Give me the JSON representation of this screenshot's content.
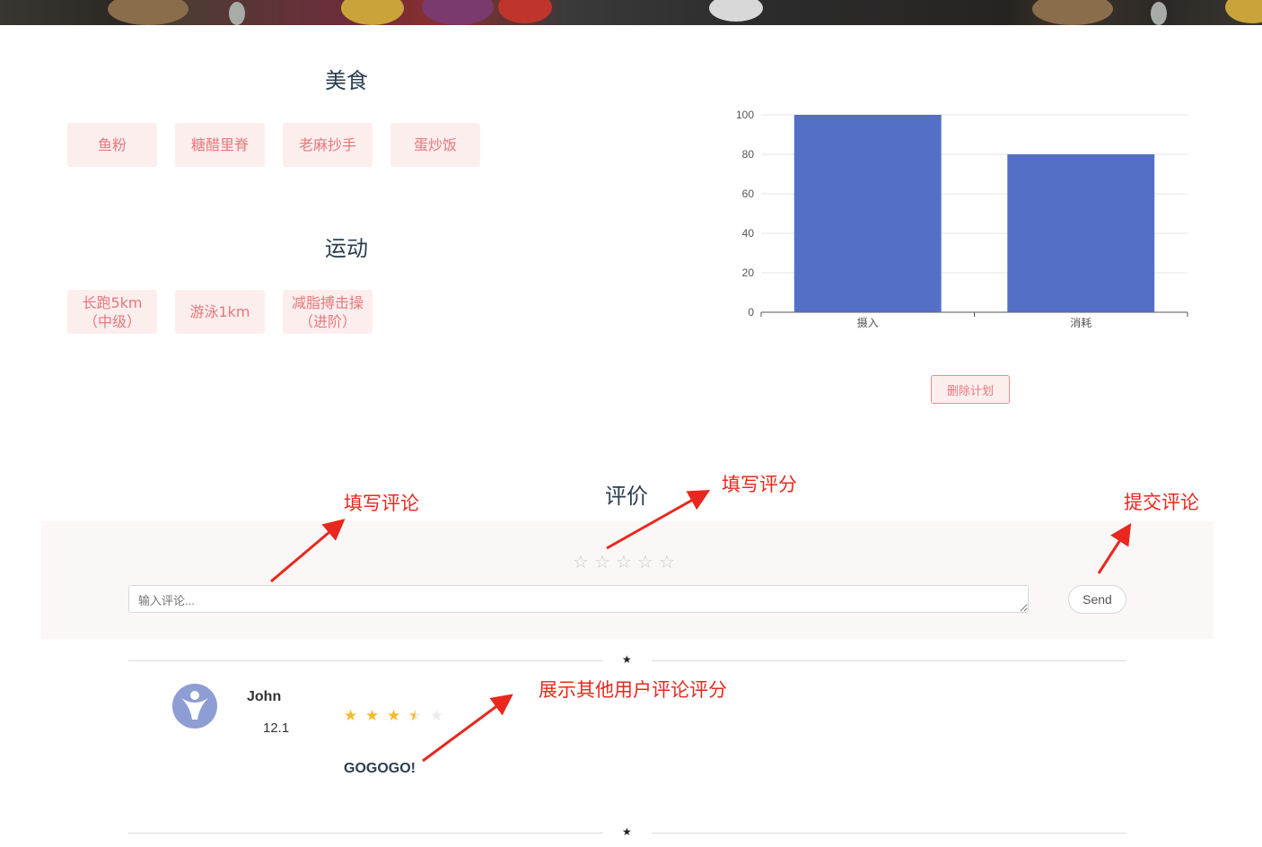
{
  "banner": {
    "description_icon": "food-banner-image"
  },
  "food": {
    "title": "美食",
    "tags": [
      "鱼粉",
      "糖醋里脊",
      "老麻抄手",
      "蛋炒饭"
    ]
  },
  "sport": {
    "title": "运动",
    "tags": [
      "长跑5km（中级）",
      "游泳1km",
      "减脂搏击操（进阶）"
    ]
  },
  "chart_data": {
    "type": "bar",
    "categories": [
      "摄入",
      "消耗"
    ],
    "values": [
      100,
      80
    ],
    "ylim": [
      0,
      100
    ],
    "yticks": [
      0,
      20,
      40,
      60,
      80,
      100
    ],
    "bar_color": "#5470c6",
    "grid": true
  },
  "plan": {
    "delete_label": "删除计划"
  },
  "review": {
    "title": "评价",
    "rating_max": 5,
    "input_placeholder": "输入评论...",
    "send_label": "Send"
  },
  "comments": [
    {
      "user": "John",
      "date": "12.1",
      "rating": 3.5,
      "text": "GOGOGO!"
    }
  ],
  "annotations": {
    "write_comment": "填写评论",
    "write_rating": "填写评分",
    "submit_comment": "提交评论",
    "show_others": "展示其他用户评论评分"
  },
  "colors": {
    "tag_bg": "#fdeeee",
    "tag_text": "#e9777a",
    "star_filled": "#f7ba2a",
    "annotation": "#e8281e"
  }
}
